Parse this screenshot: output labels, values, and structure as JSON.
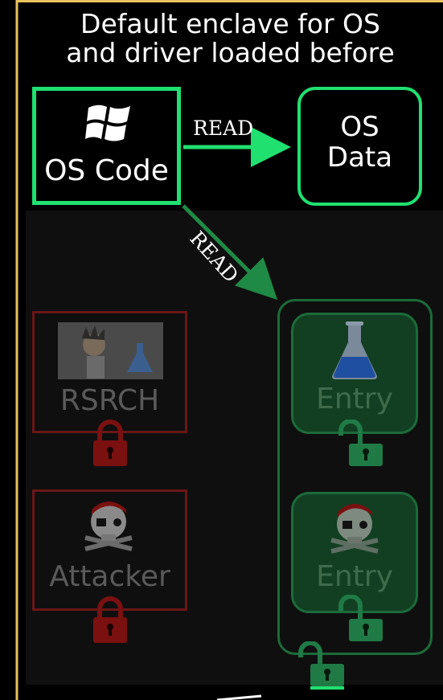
{
  "diagram": {
    "title_line1": "Default enclave for OS",
    "title_line2": "and driver loaded before",
    "os_code": {
      "label": "OS Code",
      "icon": "windows-logo-icon"
    },
    "os_data": {
      "label_line1": "OS",
      "label_line2": "Data"
    },
    "edges": [
      {
        "label": "READ",
        "from": "os_code",
        "to": "os_data"
      },
      {
        "label": "READ",
        "from": "os_code",
        "to": "enclave"
      }
    ],
    "nodes": [
      {
        "label": "RSRCH",
        "icon": "researcher-icon",
        "lock": "locked"
      },
      {
        "label": "Attacker",
        "icon": "pirate-skull-icon",
        "lock": "locked"
      },
      {
        "label": "Entry",
        "icon": "flask-icon",
        "lock": "unlocked"
      },
      {
        "label": "Entry",
        "icon": "pirate-skull-icon",
        "lock": "unlocked"
      }
    ],
    "colors": {
      "accent_green": "#20e070",
      "dim_green": "#1c6b3a",
      "dim_red": "#6a1616",
      "border_gold": "#e8c25e"
    }
  }
}
